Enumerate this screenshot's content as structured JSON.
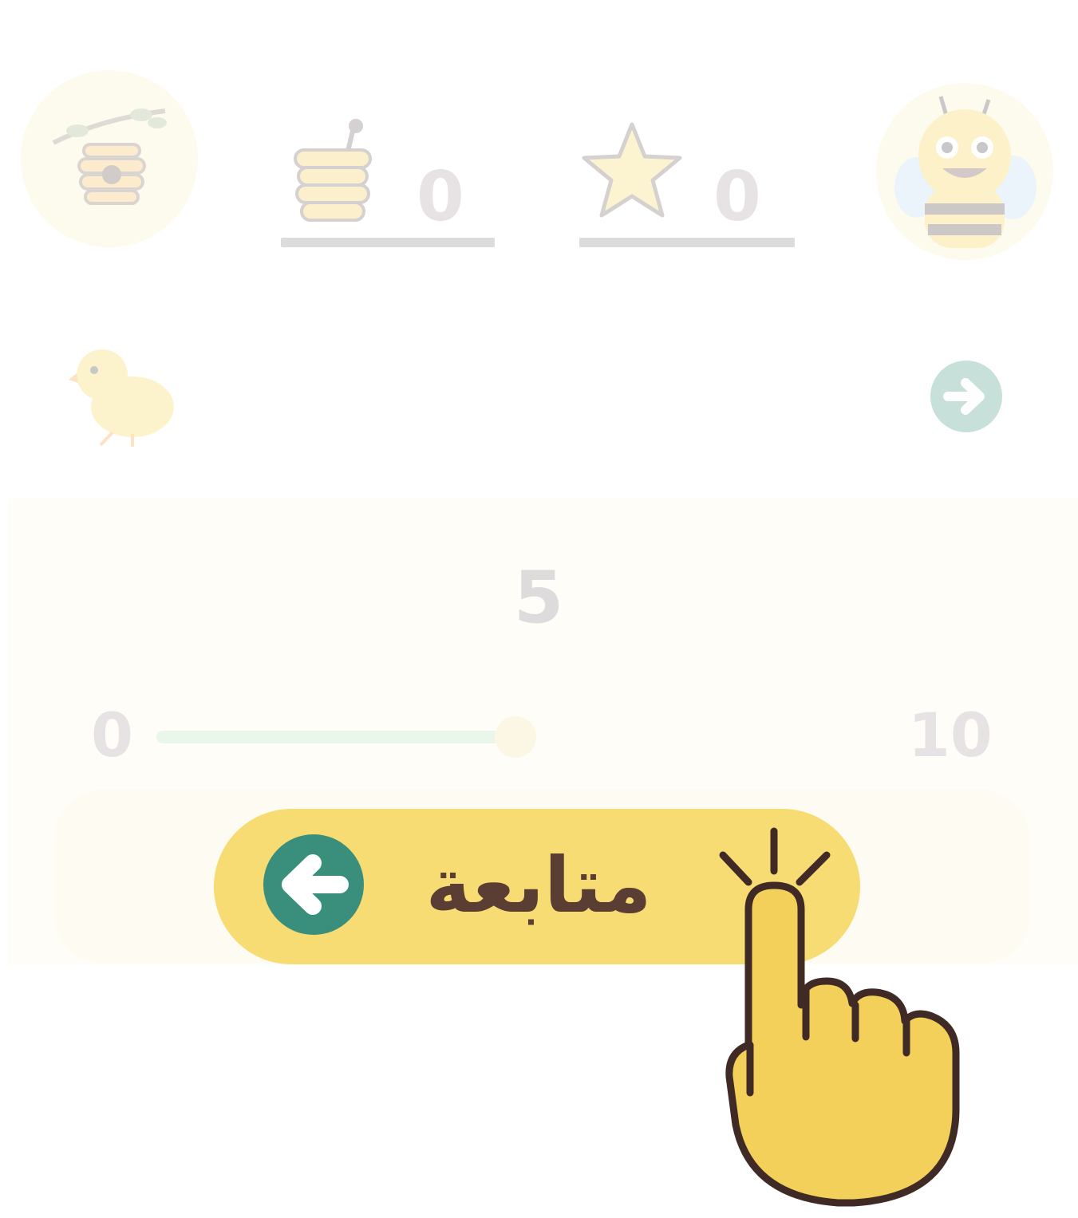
{
  "header": {
    "hive_icon": "beehive-icon",
    "honey": {
      "icon": "honey-pot-icon",
      "value": "0"
    },
    "stars": {
      "icon": "star-icon",
      "value": "0"
    },
    "avatar_icon": "bee-icon"
  },
  "nav": {
    "character_icon": "chick-icon",
    "next_icon": "arrow-right-circle-icon"
  },
  "slider": {
    "current_value": "5",
    "min_label": "0",
    "max_label": "10",
    "value": 5,
    "min": 0,
    "max": 10
  },
  "continue_button": {
    "label": "متابعة",
    "icon": "arrow-left-circle-icon"
  },
  "pointer": {
    "icon": "tap-hand-icon"
  },
  "colors": {
    "button_bg": "#f7dc73",
    "button_text": "#5a3e33",
    "arrow_circle": "#3a8f7c",
    "slider_track": "#b6dfb3",
    "slider_thumb": "#f2dd9f",
    "hand_fill": "#f3d05a",
    "hand_outline": "#3f2a25"
  }
}
